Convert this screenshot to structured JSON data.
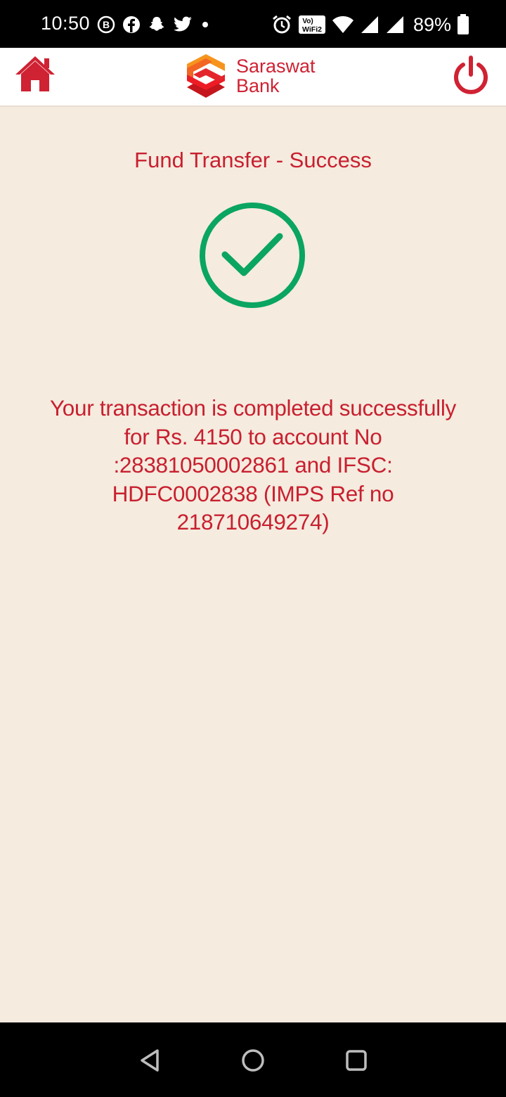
{
  "status_bar": {
    "time": "10:50",
    "battery": "89%",
    "wifi_badge_top": "Vo)",
    "wifi_badge_bottom": "WiFi2",
    "icons_left": [
      "b-badge-icon",
      "facebook-icon",
      "snapchat-icon",
      "twitter-icon",
      "dot-icon"
    ],
    "icons_right": [
      "alarm-icon",
      "vowifi-icon",
      "wifi-icon",
      "signal-icon",
      "signal-icon",
      "battery-icon"
    ]
  },
  "header": {
    "brand_line1": "Saraswat",
    "brand_line2": "Bank",
    "home_icon": "home-icon",
    "logout_icon": "power-icon"
  },
  "main": {
    "title": "Fund Transfer - Success",
    "message_lines": [
      "Your transaction is completed successfully",
      "for Rs. 4150 to account No",
      ":28381050002861 and IFSC:",
      "HDFC0002838 (IMPS Ref no",
      "218710649274)"
    ]
  },
  "colors": {
    "accent_red": "#c8202f",
    "success_green": "#0aa561",
    "background": "#f5ebdf"
  },
  "nav": {
    "icons": [
      "back-icon",
      "home-circle-icon",
      "recents-icon"
    ]
  }
}
